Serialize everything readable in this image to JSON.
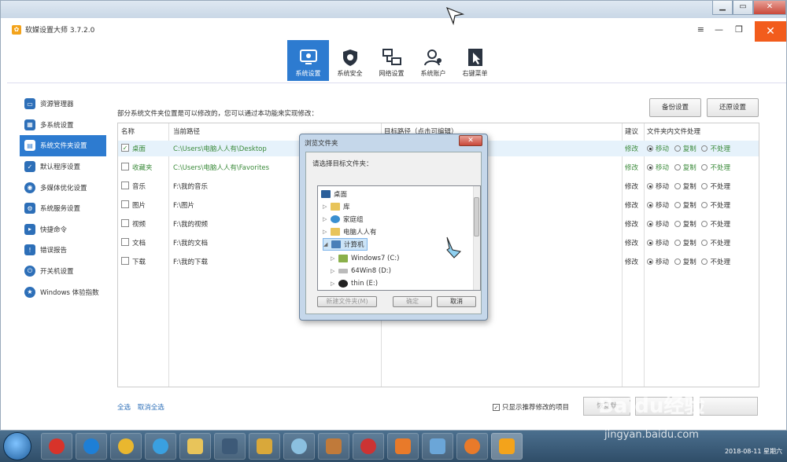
{
  "app": {
    "title": "软媒设置大师 3.7.2.0"
  },
  "nav_tabs": [
    {
      "label": "系统设置",
      "icon": "monitor-gear-icon"
    },
    {
      "label": "系统安全",
      "icon": "shield-gear-icon"
    },
    {
      "label": "网络设置",
      "icon": "network-icon"
    },
    {
      "label": "系统账户",
      "icon": "user-icon"
    },
    {
      "label": "右键菜单",
      "icon": "cursor-menu-icon"
    }
  ],
  "sidebar": {
    "items": [
      {
        "label": "资源管理器"
      },
      {
        "label": "多系统设置"
      },
      {
        "label": "系统文件夹设置"
      },
      {
        "label": "默认程序设置"
      },
      {
        "label": "多媒体优化设置"
      },
      {
        "label": "系统服务设置"
      },
      {
        "label": "快捷命令"
      },
      {
        "label": "错误报告"
      },
      {
        "label": "开关机设置"
      },
      {
        "label": "Windows 体验指数"
      }
    ]
  },
  "main": {
    "description": "部分系统文件夹位置是可以修改的，您可以通过本功能来实现修改：",
    "backup_label": "备份设置",
    "restore_label": "还原设置",
    "columns": {
      "name": "名称",
      "current": "当前路径",
      "target": "目标路径（点击可编辑）",
      "suggest": "建议",
      "handling": "文件夹内文件处理"
    },
    "radio_labels": {
      "move": "移动",
      "copy": "复制",
      "none": "不处理"
    },
    "rows": [
      {
        "name": "桌面",
        "path": "C:\\Users\\电脑人人有\\Desktop",
        "suggest": "修改",
        "checked": "✓"
      },
      {
        "name": "收藏夹",
        "path": "C:\\Users\\电脑人人有\\Favorites",
        "suggest": "修改",
        "checked": ""
      },
      {
        "name": "音乐",
        "path": "F:\\我的音乐",
        "suggest": "修改",
        "checked": ""
      },
      {
        "name": "图片",
        "path": "F:\\图片",
        "suggest": "修改",
        "checked": ""
      },
      {
        "name": "视频",
        "path": "F:\\我的视频",
        "suggest": "修改",
        "checked": ""
      },
      {
        "name": "文档",
        "path": "F:\\我的文档",
        "suggest": "修改",
        "checked": ""
      },
      {
        "name": "下载",
        "path": "F:\\我的下载",
        "suggest": "修改",
        "checked": ""
      }
    ],
    "select_all": "全选",
    "deselect_all": "取消全选",
    "recommend_only": "只显示推荐修改的项目",
    "restore_default": "恢复默"
  },
  "dialog": {
    "title": "浏览文件夹",
    "prompt": "请选择目标文件夹：",
    "tree": [
      {
        "label": "桌面"
      },
      {
        "label": "库"
      },
      {
        "label": "家庭组"
      },
      {
        "label": "电脑人人有"
      },
      {
        "label": "计算机"
      },
      {
        "label": "Windows7 (C:)"
      },
      {
        "label": "64Win8 (D:)"
      },
      {
        "label": "thin (E:)"
      }
    ],
    "new_folder": "新建文件夹(M)",
    "ok": "确定",
    "cancel": "取消"
  },
  "taskbar": {
    "date": "2018-08-11 星期六"
  },
  "watermark": {
    "brand": "Baidu经验",
    "url": "jingyan.baidu.com"
  }
}
